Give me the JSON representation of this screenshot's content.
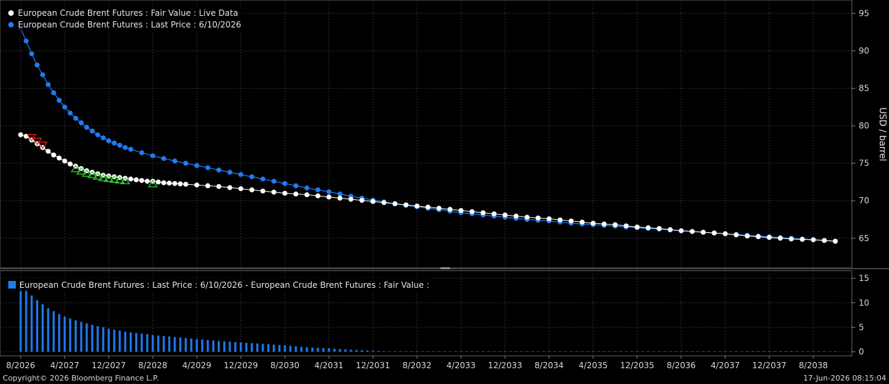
{
  "colors": {
    "background": "#000000",
    "grid": "#555555",
    "fair_value": "#ffffff",
    "last_price": "#1f7cf0",
    "up_marker": "#33cc33",
    "down_marker": "#e02020",
    "axis_text": "#d9d9d9"
  },
  "chart_data": [
    {
      "type": "line",
      "legend": [
        "European Crude Brent Futures : Fair Value : Live Data",
        "European Crude Brent Futures : Last Price : 6/10/2026"
      ],
      "ylabel": "USD / barrel",
      "y_ticks": [
        95,
        90,
        85,
        80,
        75,
        70,
        65
      ],
      "ylim": [
        61.5,
        96.5
      ],
      "grid": true,
      "legend_placement": "top-left",
      "x_range": [
        "2026-08",
        "2038-12"
      ],
      "series": [
        {
          "name": "European Crude Brent Futures : Fair Value : Live Data",
          "points": [
            [
              "2026-08",
              78.8
            ],
            [
              "2026-09",
              78.6
            ],
            [
              "2026-10",
              78.1
            ],
            [
              "2026-11",
              77.6
            ],
            [
              "2026-12",
              77.1
            ],
            [
              "2027-01",
              76.6
            ],
            [
              "2027-02",
              76.1
            ],
            [
              "2027-03",
              75.7
            ],
            [
              "2027-04",
              75.3
            ],
            [
              "2027-05",
              74.9
            ],
            [
              "2027-06",
              74.6
            ],
            [
              "2027-07",
              74.3
            ],
            [
              "2027-08",
              74.0
            ],
            [
              "2027-09",
              73.8
            ],
            [
              "2027-10",
              73.6
            ],
            [
              "2027-11",
              73.4
            ],
            [
              "2027-12",
              73.3
            ],
            [
              "2028-01",
              73.2
            ],
            [
              "2028-02",
              73.1
            ],
            [
              "2028-03",
              73.0
            ],
            [
              "2028-04",
              72.9
            ],
            [
              "2028-05",
              72.8
            ],
            [
              "2028-06",
              72.7
            ],
            [
              "2028-07",
              72.6
            ],
            [
              "2028-08",
              72.6
            ],
            [
              "2028-09",
              72.5
            ],
            [
              "2028-10",
              72.4
            ],
            [
              "2028-12",
              72.3
            ],
            [
              "2029-04",
              72.1
            ],
            [
              "2029-08",
              71.9
            ],
            [
              "2029-12",
              71.6
            ],
            [
              "2030-04",
              71.3
            ],
            [
              "2030-08",
              71.0
            ],
            [
              "2030-12",
              70.8
            ],
            [
              "2031-04",
              70.5
            ],
            [
              "2031-08",
              70.2
            ],
            [
              "2031-12",
              69.9
            ],
            [
              "2032-04",
              69.6
            ],
            [
              "2032-08",
              69.3
            ],
            [
              "2032-12",
              69.0
            ],
            [
              "2033-04",
              68.7
            ],
            [
              "2033-08",
              68.4
            ],
            [
              "2033-12",
              68.1
            ],
            [
              "2034-04",
              67.8
            ],
            [
              "2034-08",
              67.6
            ],
            [
              "2034-12",
              67.3
            ],
            [
              "2035-04",
              67.0
            ],
            [
              "2035-08",
              66.8
            ],
            [
              "2035-12",
              66.5
            ],
            [
              "2036-04",
              66.3
            ],
            [
              "2036-08",
              66.0
            ],
            [
              "2036-12",
              65.8
            ],
            [
              "2037-04",
              65.6
            ],
            [
              "2037-08",
              65.3
            ],
            [
              "2037-12",
              65.1
            ],
            [
              "2038-04",
              64.9
            ],
            [
              "2038-08",
              64.8
            ],
            [
              "2038-12",
              64.6
            ]
          ]
        },
        {
          "name": "European Crude Brent Futures : Last Price : 6/10/2026",
          "points": [
            [
              "2026-08",
              93.0
            ],
            [
              "2026-09",
              91.3
            ],
            [
              "2026-10",
              89.6
            ],
            [
              "2026-11",
              88.1
            ],
            [
              "2026-12",
              86.8
            ],
            [
              "2027-01",
              85.5
            ],
            [
              "2027-02",
              84.4
            ],
            [
              "2027-03",
              83.4
            ],
            [
              "2027-04",
              82.5
            ],
            [
              "2027-05",
              81.7
            ],
            [
              "2027-06",
              81.0
            ],
            [
              "2027-07",
              80.4
            ],
            [
              "2027-08",
              79.8
            ],
            [
              "2027-09",
              79.3
            ],
            [
              "2027-10",
              78.8
            ],
            [
              "2027-11",
              78.4
            ],
            [
              "2027-12",
              78.0
            ],
            [
              "2028-03",
              77.1
            ],
            [
              "2028-06",
              76.4
            ],
            [
              "2028-09",
              75.8
            ],
            [
              "2028-12",
              75.3
            ],
            [
              "2029-04",
              74.7
            ],
            [
              "2029-08",
              74.1
            ],
            [
              "2029-12",
              73.5
            ],
            [
              "2030-04",
              72.9
            ],
            [
              "2030-08",
              72.3
            ],
            [
              "2030-12",
              71.7
            ],
            [
              "2031-04",
              71.2
            ],
            [
              "2031-08",
              70.6
            ],
            [
              "2031-12",
              70.1
            ],
            [
              "2032-04",
              69.6
            ],
            [
              "2032-08",
              69.2
            ],
            [
              "2032-12",
              68.8
            ],
            [
              "2033-04",
              68.4
            ],
            [
              "2033-08",
              68.1
            ],
            [
              "2033-12",
              67.8
            ],
            [
              "2034-04",
              67.5
            ],
            [
              "2034-08",
              67.3
            ],
            [
              "2034-12",
              67.0
            ],
            [
              "2035-04",
              66.8
            ],
            [
              "2035-08",
              66.6
            ],
            [
              "2035-12",
              66.4
            ],
            [
              "2036-04",
              66.2
            ],
            [
              "2036-08",
              66.0
            ],
            [
              "2036-12",
              65.8
            ],
            [
              "2037-04",
              65.6
            ],
            [
              "2037-08",
              65.4
            ],
            [
              "2037-12",
              65.2
            ],
            [
              "2038-04",
              65.0
            ],
            [
              "2038-08",
              64.8
            ],
            [
              "2038-12",
              64.6
            ]
          ]
        }
      ],
      "markers": {
        "down": [
          "2026-10",
          "2026-11",
          "2026-12"
        ],
        "up": [
          "2027-06",
          "2027-07",
          "2027-08",
          "2027-09",
          "2027-10",
          "2027-11",
          "2027-12",
          "2028-01",
          "2028-02",
          "2028-03",
          "2028-08"
        ]
      }
    },
    {
      "type": "bar",
      "legend": [
        "European Crude Brent Futures : Last Price : 6/10/2026 - European Crude Brent Futures : Fair Value :"
      ],
      "y_ticks": [
        15,
        10,
        5,
        0
      ],
      "ylim": [
        0,
        16
      ],
      "grid": true,
      "legend_placement": "top-left",
      "x_range": [
        "2026-08",
        "2038-12"
      ],
      "note": "bar value = Last Price minus Fair Value, monthly"
    }
  ],
  "x_axis": {
    "ticks": [
      "8/2026",
      "4/2027",
      "12/2027",
      "8/2028",
      "4/2029",
      "12/2029",
      "8/2030",
      "4/2031",
      "12/2031",
      "8/2032",
      "4/2033",
      "12/2033",
      "8/2034",
      "4/2035",
      "12/2035",
      "8/2036",
      "4/2037",
      "12/2037",
      "8/2038"
    ],
    "tick_months": [
      "2026-08",
      "2027-04",
      "2027-12",
      "2028-08",
      "2029-04",
      "2029-12",
      "2030-08",
      "2031-04",
      "2031-12",
      "2032-08",
      "2033-04",
      "2033-12",
      "2034-08",
      "2035-04",
      "2035-12",
      "2036-08",
      "2037-04",
      "2037-12",
      "2038-08"
    ]
  },
  "footer": {
    "copyright": "Copyright© 2026 Bloomberg Finance L.P.",
    "timestamp": "17-Jun-2026 08:15:04"
  }
}
